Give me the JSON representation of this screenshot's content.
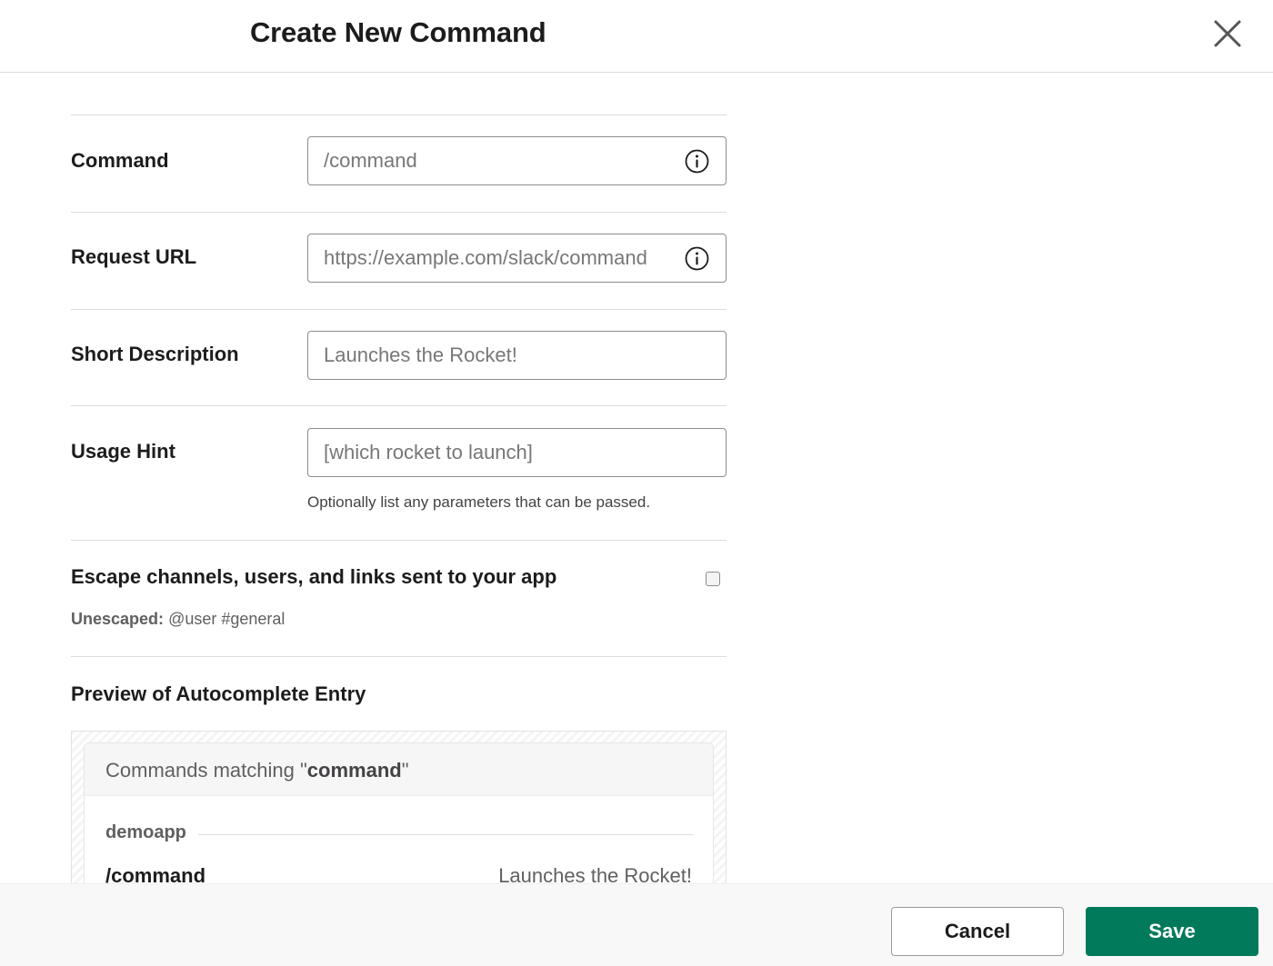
{
  "header": {
    "title": "Create New Command",
    "close_icon": "close-icon"
  },
  "fields": {
    "command": {
      "label": "Command",
      "placeholder": "/command",
      "icon": "info-icon"
    },
    "request_url": {
      "label": "Request URL",
      "placeholder": "https://example.com/slack/command",
      "icon": "info-icon"
    },
    "short_description": {
      "label": "Short Description",
      "placeholder": "Launches the Rocket!"
    },
    "usage_hint": {
      "label": "Usage Hint",
      "placeholder": "[which rocket to launch]",
      "help": "Optionally list any parameters that can be passed."
    }
  },
  "escape": {
    "label": "Escape channels, users, and links sent to your app",
    "checked": false,
    "unescaped_label": "Unescaped:",
    "unescaped_value": "@user #general"
  },
  "preview": {
    "title": "Preview of Autocomplete Entry",
    "matching_prefix": "Commands matching \"",
    "matching_term": "command",
    "matching_suffix": "\"",
    "app_name": "demoapp",
    "command": "/command",
    "description": "Launches the Rocket!"
  },
  "footer": {
    "cancel_label": "Cancel",
    "save_label": "Save"
  },
  "colors": {
    "primary": "#007a5a",
    "text": "#1d1c1d",
    "muted": "#616061",
    "border": "#dddddd"
  }
}
